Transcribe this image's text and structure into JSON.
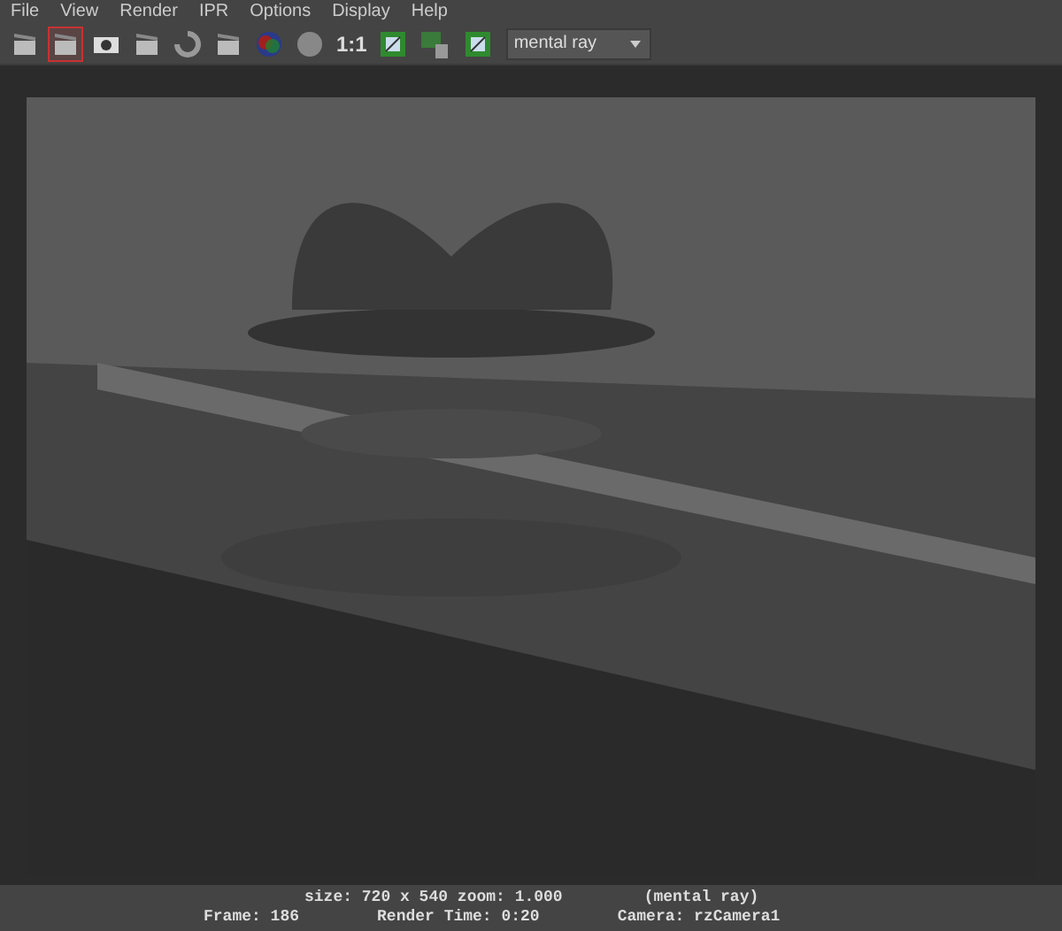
{
  "menu_bar": [
    "File",
    "View",
    "Render",
    "IPR",
    "Options",
    "Display",
    "Help"
  ],
  "toolbar": {
    "tools": [
      {
        "kind": "clapper",
        "selected": false
      },
      {
        "kind": "clapper",
        "selected": true
      },
      {
        "kind": "camera",
        "selected": false
      },
      {
        "kind": "clapper",
        "selected": false
      },
      {
        "kind": "refresh",
        "selected": false
      },
      {
        "kind": "clapper",
        "selected": false
      },
      {
        "kind": "rgb",
        "selected": false
      },
      {
        "kind": "sphere",
        "selected": false
      },
      {
        "kind": "text",
        "label": "1:1",
        "selected": false
      },
      {
        "kind": "picture",
        "selected": false
      },
      {
        "kind": "picture-trash",
        "selected": false
      },
      {
        "kind": "picture",
        "selected": false
      }
    ],
    "renderer": {
      "value": "mental ray"
    }
  },
  "status": {
    "line_1": [
      "size: 720 x 540 zoom: 1.000",
      "(mental ray)"
    ],
    "line_2": [
      "Frame: 186",
      "Render Time: 0:20",
      "Camera: rzCamera1"
    ]
  }
}
